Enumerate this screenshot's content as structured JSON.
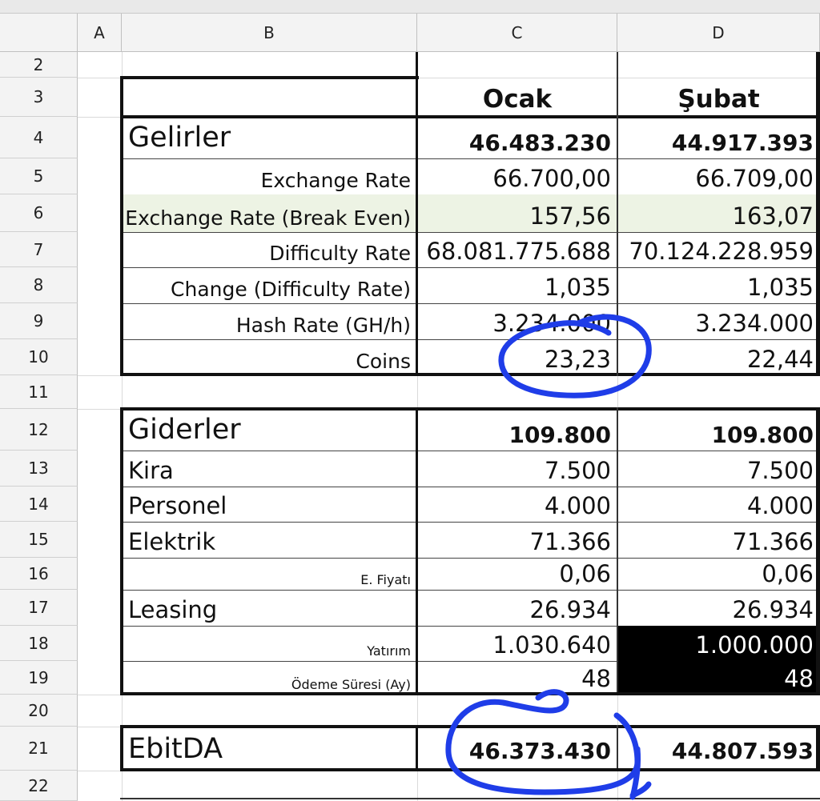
{
  "columns": {
    "a": "A",
    "b": "B",
    "c": "C",
    "d": "D"
  },
  "rows": [
    "2",
    "3",
    "4",
    "5",
    "6",
    "7",
    "8",
    "9",
    "10",
    "11",
    "12",
    "13",
    "14",
    "15",
    "16",
    "17",
    "18",
    "19",
    "20",
    "21",
    "22"
  ],
  "header": {
    "c": "Ocak",
    "d": "Şubat"
  },
  "income": {
    "title": "Gelirler",
    "total_c": "46.483.230",
    "total_d": "44.917.393",
    "rows": [
      {
        "label": "Exchange Rate",
        "c": "66.700,00",
        "d": "66.709,00"
      },
      {
        "label": "Exchange Rate (Break Even)",
        "c": "157,56",
        "d": "163,07"
      },
      {
        "label": "Difficulty Rate",
        "c": "68.081.775.688",
        "d": "70.124.228.959"
      },
      {
        "label": "Change (Difficulty Rate)",
        "c": "1,035",
        "d": "1,035"
      },
      {
        "label": "Hash Rate (GH/h)",
        "c": "3.234.000",
        "d": "3.234.000"
      },
      {
        "label": "Coins",
        "c": "23,23",
        "d": "22,44"
      }
    ]
  },
  "expenses": {
    "title": "Giderler",
    "total_c": "109.800",
    "total_d": "109.800",
    "rows": [
      {
        "label": "Kira",
        "c": "7.500",
        "d": "7.500"
      },
      {
        "label": "Personel",
        "c": "4.000",
        "d": "4.000"
      },
      {
        "label": "Elektrik",
        "c": "71.366",
        "d": "71.366"
      },
      {
        "label": "E. Fiyatı",
        "c": "0,06",
        "d": "0,06"
      },
      {
        "label": "Leasing",
        "c": "26.934",
        "d": "26.934"
      },
      {
        "label": "Yatırım",
        "c": "1.030.640",
        "d": "1.000.000"
      },
      {
        "label": "Ödeme Süresi (Ay)",
        "c": "48",
        "d": "48"
      }
    ]
  },
  "ebitda": {
    "label": "EbitDA",
    "c": "46.373.430",
    "d": "44.807.593"
  },
  "colors": {
    "annotation": "#1f3de8",
    "highlight": "#edf3e4",
    "inverted": "#000000"
  }
}
